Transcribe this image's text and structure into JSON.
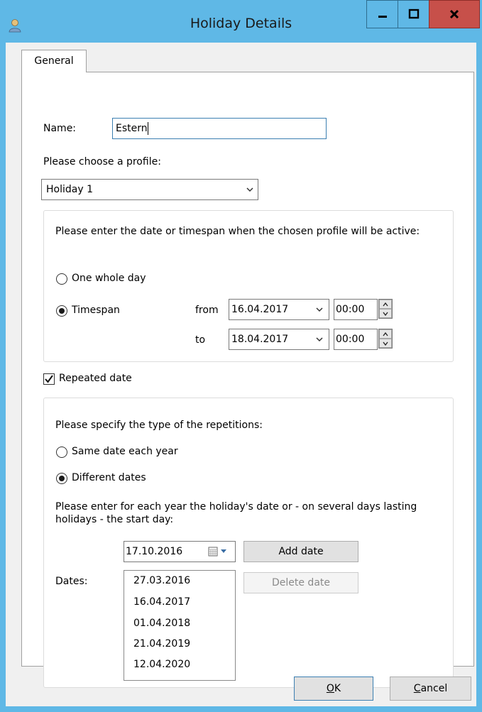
{
  "window": {
    "title": "Holiday Details"
  },
  "tabs": [
    {
      "label": "General"
    }
  ],
  "form": {
    "name_label": "Name:",
    "name_value": "Estern",
    "profile_label": "Please choose a profile:",
    "profile_value": "Holiday 1"
  },
  "timespan_group": {
    "instruction": "Please enter the date or timespan when the chosen profile will be active:",
    "one_day_label": "One whole day",
    "one_day_selected": false,
    "timespan_label": "Timespan",
    "timespan_selected": true,
    "from_label": "from",
    "from_date": "16.04.2017",
    "from_time": "00:00",
    "to_label": "to",
    "to_date": "18.04.2017",
    "to_time": "00:00"
  },
  "repeated": {
    "checkbox_label": "Repeated date",
    "checked": true
  },
  "repetition_group": {
    "instruction": "Please specify the type of the repetitions:",
    "same_date_label": "Same date each year",
    "same_date_selected": false,
    "different_dates_label": "Different dates",
    "different_dates_selected": true,
    "dates_instruction": "Please enter for each year the holiday's date or - on several days lasting holidays - the start day:",
    "date_picker_value": "17.10.2016",
    "add_button": "Add date",
    "delete_button": "Delete date",
    "dates_label": "Dates:",
    "dates": [
      "27.03.2016",
      "16.04.2017",
      "01.04.2018",
      "21.04.2019",
      "12.04.2020"
    ]
  },
  "footer": {
    "ok_label": "OK",
    "ok_mnemonic": "O",
    "ok_rest": "K",
    "cancel_label": "Cancel",
    "cancel_mnemonic": "C",
    "cancel_rest": "ancel"
  },
  "colors": {
    "titlebar": "#5fb8e6",
    "close_button": "#c7504a",
    "focus_border": "#3c7fb1"
  }
}
